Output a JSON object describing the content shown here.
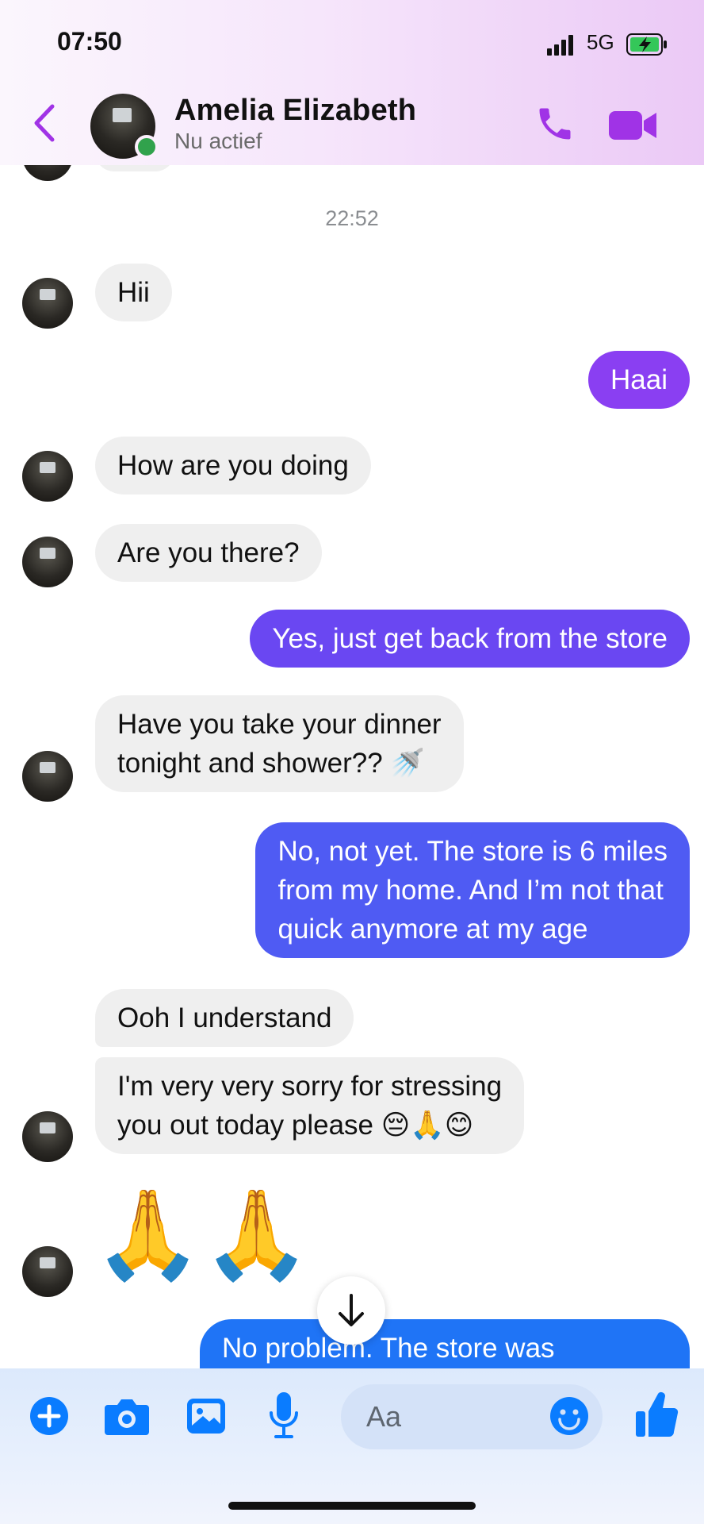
{
  "status_bar": {
    "time": "07:50",
    "network": "5G"
  },
  "header": {
    "name": "Amelia Elizabeth",
    "status": "Nu actief"
  },
  "chat": {
    "timestamp": "22:52",
    "messages": [
      {
        "dir": "in",
        "text": "Hii"
      },
      {
        "dir": "out",
        "text": "Haai"
      },
      {
        "dir": "in",
        "text": "How are you doing"
      },
      {
        "dir": "in",
        "text": "Are you there?"
      },
      {
        "dir": "out",
        "text": "Yes, just get back from the store"
      },
      {
        "dir": "in",
        "line1": "Have you take your dinner",
        "line2": "tonight and shower?? 🚿"
      },
      {
        "dir": "out",
        "line1": "No, not yet. The store is 6 miles",
        "line2": "from my home. And I’m not that",
        "line3": "quick anymore at my age"
      },
      {
        "dir": "in",
        "text": "Ooh I understand"
      },
      {
        "dir": "in",
        "line1": "I'm very very sorry for stressing",
        "line2": "you out today please 😔🙏😊"
      },
      {
        "dir": "in",
        "emoji": "🙏🙏"
      },
      {
        "dir": "out",
        "text": "No problem. The store was"
      }
    ]
  },
  "composer": {
    "placeholder": "Aa"
  },
  "colors": {
    "accent": "#a033e6",
    "messenger_blue": "#0a7cff",
    "incoming_bubble": "#efefef"
  },
  "icons": [
    "back-chevron-icon",
    "phone-icon",
    "video-camera-icon",
    "plus-icon",
    "camera-icon",
    "image-icon",
    "microphone-icon",
    "emoji-icon",
    "thumbs-up-icon",
    "arrow-down-icon"
  ]
}
